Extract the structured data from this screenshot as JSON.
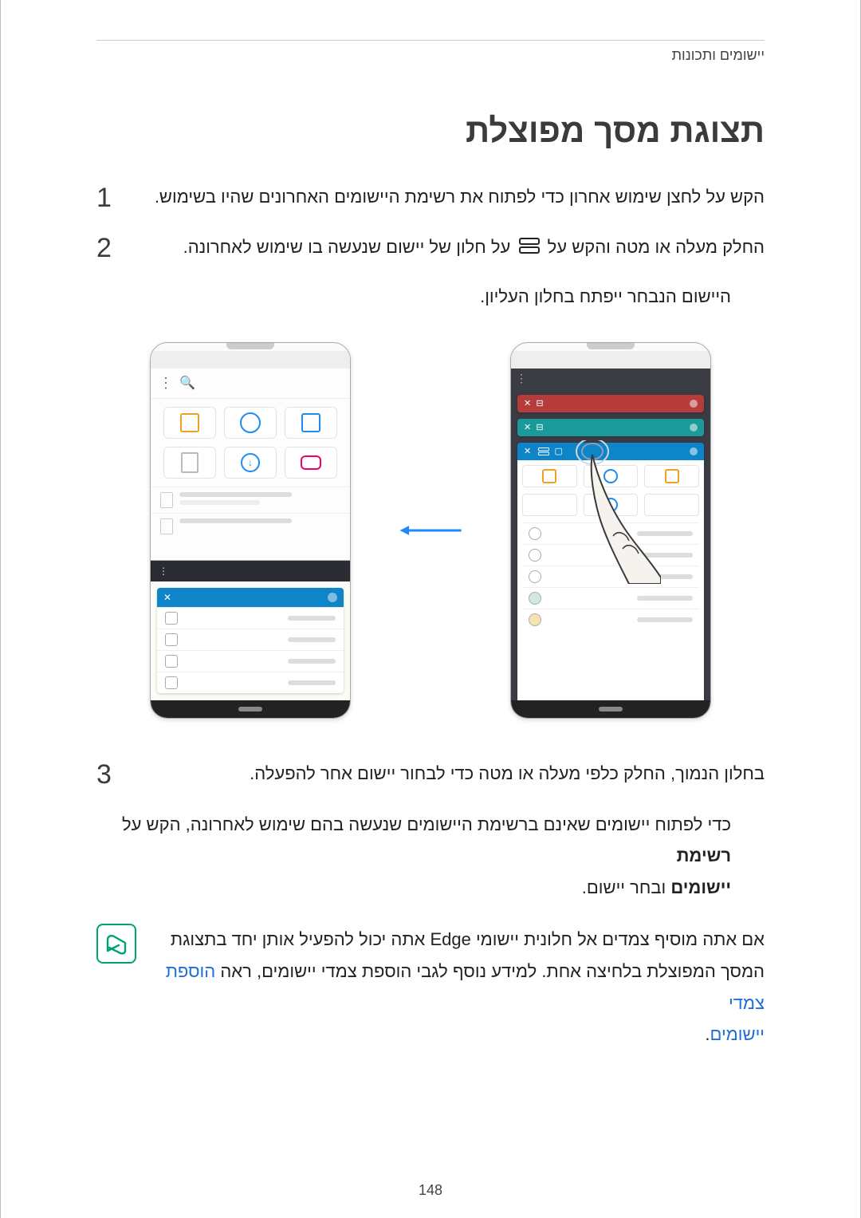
{
  "header": {
    "breadcrumb": "יישומים ותכונות"
  },
  "section": {
    "title": "תצוגת מסך מפוצלת"
  },
  "steps": {
    "s1": {
      "num": "1",
      "text": "הקש על לחצן שימוש אחרון כדי לפתוח את רשימת היישומים האחרונים שהיו בשימוש."
    },
    "s2": {
      "num": "2",
      "text_before_icon": "החלק מעלה או מטה והקש על",
      "text_after_icon": "על חלון של יישום שנעשה בו שימוש לאחרונה."
    },
    "s2_sub": "היישום הנבחר ייפתח בחלון העליון.",
    "s3": {
      "num": "3",
      "text": "בחלון הנמוך, החלק כלפי מעלה או מטה כדי לבחור יישום אחר להפעלה."
    }
  },
  "after_para": {
    "line1_pre": "כדי לפתוח יישומים שאינם ברשימת היישומים שנעשה בהם שימוש לאחרונה, הקש על ",
    "bold1": "רשימת",
    "bold2": "יישומים",
    "line2_post": " ובחר יישום."
  },
  "note": {
    "line1": "אם אתה מוסיף צמדים אל חלונית יישומי Edge אתה יכול להפעיל אותן יחד בתצוגת",
    "line2_pre": "המסך המפוצלת בלחיצה אחת. למידע נוסף לגבי הוספת צמדי יישומים, ראה ",
    "link_text": "הוספת צמדי",
    "line3_link_cont": "יישומים",
    "period": "."
  },
  "icons": {
    "split_view": "split-view-icon",
    "arrow": "arrow-left",
    "note": "note-icon"
  },
  "page_number": "148"
}
